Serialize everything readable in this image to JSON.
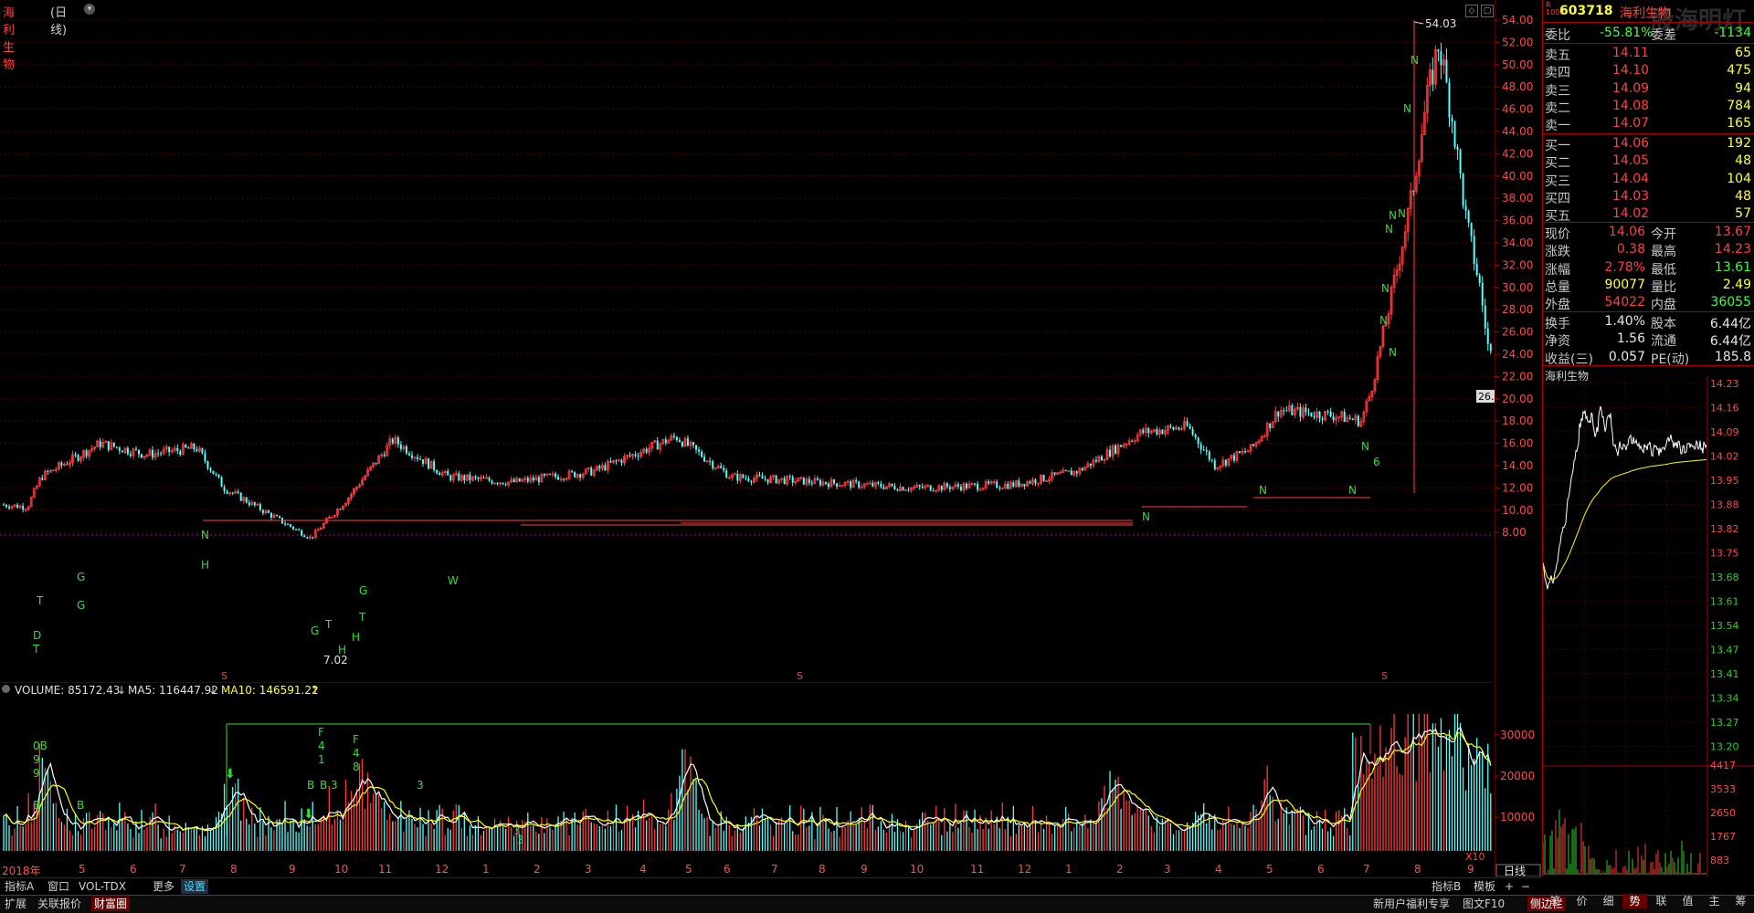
{
  "stock": {
    "name": "海利生物",
    "period": "(日线)",
    "code": "603718",
    "watermark": "股海明灯",
    "mini_title": "海利生物"
  },
  "price_labels": {
    "high_label": "54.03",
    "low_label": "7.02",
    "last_tag": "26."
  },
  "price_axis": [
    "54.00",
    "52.00",
    "50.00",
    "48.00",
    "46.00",
    "44.00",
    "42.00",
    "40.00",
    "38.00",
    "36.00",
    "34.00",
    "32.00",
    "30.00",
    "28.00",
    "26.00",
    "24.00",
    "22.00",
    "20.00",
    "18.00",
    "16.00",
    "14.00",
    "12.00",
    "10.00",
    "8.00"
  ],
  "volume_axis": [
    "30000",
    "20000",
    "10000"
  ],
  "volume_unit": "X10",
  "indicator_header": {
    "volume_label": "VOLUME: 85172.43",
    "ma5_label": "MA5: 116447.92",
    "ma10_label": "MA10: 146591.22"
  },
  "months": [
    "2018年",
    "5",
    "6",
    "7",
    "8",
    "9",
    "10",
    "11",
    "12",
    "1",
    "2",
    "3",
    "4",
    "5",
    "6",
    "7",
    "8",
    "9",
    "10",
    "11",
    "12",
    "1",
    "2",
    "3",
    "4",
    "5",
    "6",
    "7",
    "8",
    "9"
  ],
  "period_button": "日线",
  "order_book": {
    "ratio_label": "委比",
    "ratio_value": "-55.81%",
    "diff_label": "委差",
    "diff_value": "-1134",
    "asks": [
      {
        "label": "卖五",
        "price": "14.11",
        "vol": "65"
      },
      {
        "label": "卖四",
        "price": "14.10",
        "vol": "475"
      },
      {
        "label": "卖三",
        "price": "14.09",
        "vol": "94"
      },
      {
        "label": "卖二",
        "price": "14.08",
        "vol": "784"
      },
      {
        "label": "卖一",
        "price": "14.07",
        "vol": "165"
      }
    ],
    "bids": [
      {
        "label": "买一",
        "price": "14.06",
        "vol": "192"
      },
      {
        "label": "买二",
        "price": "14.05",
        "vol": "48"
      },
      {
        "label": "买三",
        "price": "14.04",
        "vol": "104"
      },
      {
        "label": "买四",
        "price": "14.03",
        "vol": "48"
      },
      {
        "label": "买五",
        "price": "14.02",
        "vol": "57"
      }
    ]
  },
  "stats": [
    {
      "l1": "现价",
      "v1": "14.06",
      "l2": "今开",
      "v2": "13.67"
    },
    {
      "l1": "涨跌",
      "v1": "0.38",
      "l2": "最高",
      "v2": "14.23"
    },
    {
      "l1": "涨幅",
      "v1": "2.78%",
      "l2": "最低",
      "v2": "13.61"
    },
    {
      "l1": "总量",
      "v1": "90077",
      "l2": "量比",
      "v2": "2.49"
    },
    {
      "l1": "外盘",
      "v1": "54022",
      "l2": "内盘",
      "v2": "36055"
    }
  ],
  "stats2": [
    {
      "l1": "换手",
      "v1": "1.40%",
      "l2": "股本",
      "v2": "6.44亿"
    },
    {
      "l1": "净资",
      "v1": "1.56",
      "l2": "流通",
      "v2": "6.44亿"
    },
    {
      "l1": "收益(三)",
      "v1": "0.057",
      "l2": "PE(动)",
      "v2": "185.8"
    }
  ],
  "intraday_axis": [
    "14.23",
    "14.16",
    "14.09",
    "14.02",
    "13.95",
    "13.88",
    "13.82",
    "13.75",
    "13.68",
    "13.61",
    "13.54",
    "13.47",
    "13.41",
    "13.34",
    "13.27",
    "13.20"
  ],
  "intraday_vol_axis": [
    "4417",
    "3533",
    "2650",
    "1767",
    "883"
  ],
  "tabs_mid": [
    "指标A",
    "窗口",
    "VOL-TDX",
    "更多",
    "设置"
  ],
  "tabs_bottom": [
    "扩展",
    "关联报价",
    "财富圈"
  ],
  "right_tabs_mid": [
    "指标B",
    "模板"
  ],
  "right_tabs_bottom": [
    "新用户福利专享",
    "图文F10",
    "侧边栏"
  ],
  "quote_tabs": [
    "笔",
    "价",
    "细",
    "势",
    "联",
    "值",
    "主",
    "筹"
  ],
  "colors": {
    "up": "#ff3c3c",
    "down": "#54ffff",
    "ma_white": "#ffffff",
    "ma_yellow": "#ffff00",
    "grid": "#8b0000"
  }
}
